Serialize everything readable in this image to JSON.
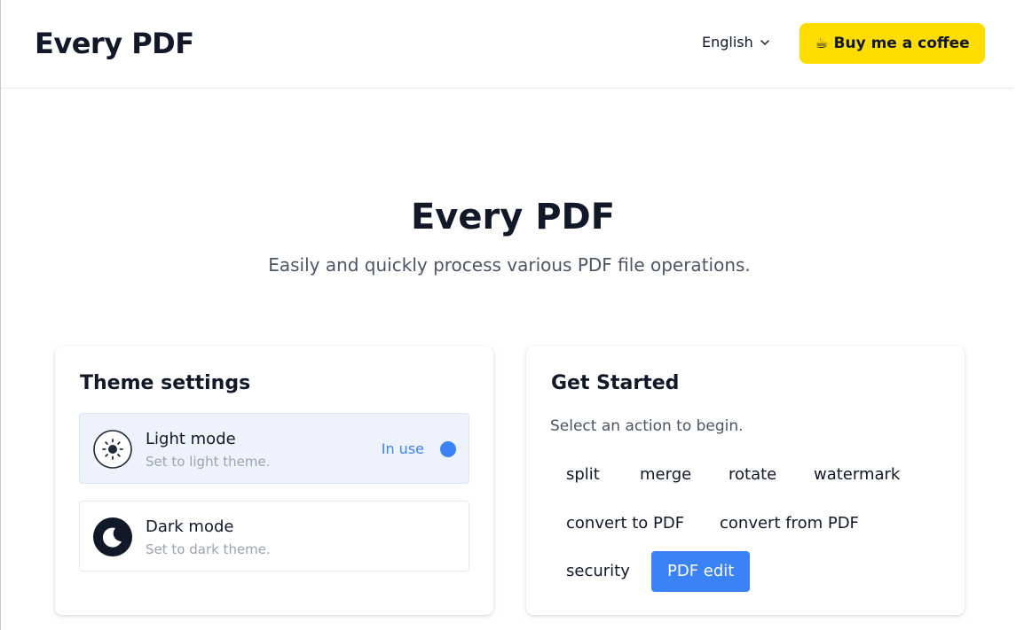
{
  "header": {
    "logo": "Every PDF",
    "language": "English",
    "coffee_label": "Buy me a coffee",
    "coffee_emoji": "☕"
  },
  "hero": {
    "title": "Every PDF",
    "subtitle": "Easily and quickly process various PDF file operations."
  },
  "theme": {
    "title": "Theme settings",
    "options": [
      {
        "name": "Light mode",
        "desc": "Set to light theme.",
        "icon": "sun-icon",
        "status": "In use"
      },
      {
        "name": "Dark mode",
        "desc": "Set to dark theme.",
        "icon": "moon-icon"
      }
    ]
  },
  "start": {
    "title": "Get Started",
    "description": "Select an action to begin.",
    "actions": [
      {
        "label": "split"
      },
      {
        "label": "merge"
      },
      {
        "label": "rotate"
      },
      {
        "label": "watermark"
      },
      {
        "label": "convert to PDF"
      },
      {
        "label": "convert from PDF"
      },
      {
        "label": "security"
      },
      {
        "label": "PDF edit",
        "active": true
      }
    ]
  },
  "colors": {
    "accent": "#3b82f6",
    "coffee": "#ffdd00",
    "light_selected_bg": "#eef2fd",
    "text": "#111827",
    "muted": "#9ca3af"
  }
}
